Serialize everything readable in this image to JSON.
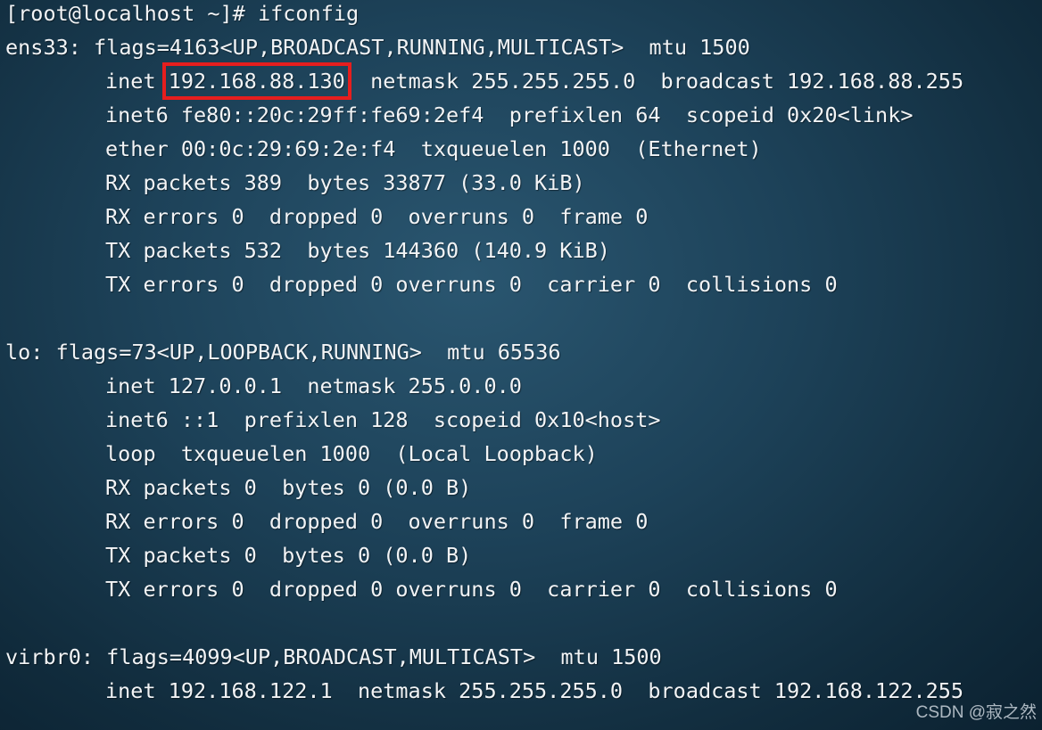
{
  "terminal": {
    "prompt_line": "[root@localhost ~]# ifconfig",
    "ens33": {
      "header": "ens33: flags=4163<UP,BROADCAST,RUNNING,MULTICAST>  mtu 1500",
      "inet_label": "inet ",
      "inet_ip": "192.168.88.130",
      "inet_rest": "  netmask 255.255.255.0  broadcast 192.168.88.255",
      "inet6": "inet6 fe80::20c:29ff:fe69:2ef4  prefixlen 64  scopeid 0x20<link>",
      "ether": "ether 00:0c:29:69:2e:f4  txqueuelen 1000  (Ethernet)",
      "rx_packets": "RX packets 389  bytes 33877 (33.0 KiB)",
      "rx_errors": "RX errors 0  dropped 0  overruns 0  frame 0",
      "tx_packets": "TX packets 532  bytes 144360 (140.9 KiB)",
      "tx_errors": "TX errors 0  dropped 0 overruns 0  carrier 0  collisions 0"
    },
    "lo": {
      "header": "lo: flags=73<UP,LOOPBACK,RUNNING>  mtu 65536",
      "inet": "inet 127.0.0.1  netmask 255.0.0.0",
      "inet6": "inet6 ::1  prefixlen 128  scopeid 0x10<host>",
      "loop": "loop  txqueuelen 1000  (Local Loopback)",
      "rx_packets": "RX packets 0  bytes 0 (0.0 B)",
      "rx_errors": "RX errors 0  dropped 0  overruns 0  frame 0",
      "tx_packets": "TX packets 0  bytes 0 (0.0 B)",
      "tx_errors": "TX errors 0  dropped 0 overruns 0  carrier 0  collisions 0"
    },
    "virbr0": {
      "header": "virbr0: flags=4099<UP,BROADCAST,MULTICAST>  mtu 1500",
      "inet": "inet 192.168.122.1  netmask 255.255.255.0  broadcast 192.168.122.255"
    }
  },
  "watermark": "CSDN @寂之然",
  "colors": {
    "highlight_box": "#e61e1e",
    "text": "#f2f4f6"
  }
}
